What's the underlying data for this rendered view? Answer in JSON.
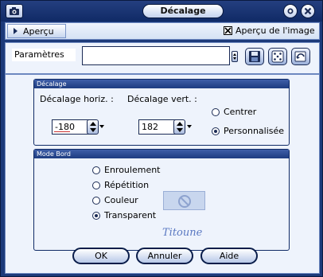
{
  "window": {
    "title": "Décalage"
  },
  "toolbar": {
    "preview_tab_label": "Aperçu",
    "preview_image_label": "Aperçu de l'image",
    "preview_image_checked": true
  },
  "params": {
    "label": "Paramètres",
    "value": ""
  },
  "offset_group": {
    "title": "Décalage",
    "horiz_label": "Décalage horiz. :",
    "horiz_value": "-180",
    "vert_label": "Décalage vert. :",
    "vert_value": "182",
    "options": [
      {
        "label": "Centrer",
        "selected": false
      },
      {
        "label": "Personnalisée",
        "selected": true
      }
    ]
  },
  "edge_group": {
    "title": "Mode Bord",
    "options": [
      {
        "label": "Enroulement",
        "selected": false
      },
      {
        "label": "Répétition",
        "selected": false
      },
      {
        "label": "Couleur",
        "selected": false
      },
      {
        "label": "Transparent",
        "selected": true
      }
    ]
  },
  "signature": "Titoune",
  "buttons": {
    "ok": "OK",
    "cancel": "Annuler",
    "help": "Aide"
  },
  "icons": {
    "window_icon": "camera-icon",
    "minimize": "minimize-icon",
    "close": "close-icon",
    "save_preset": "floppy-disk-icon",
    "random": "dice-icon",
    "reset": "reset-icon",
    "no_color": "no-color-icon"
  }
}
